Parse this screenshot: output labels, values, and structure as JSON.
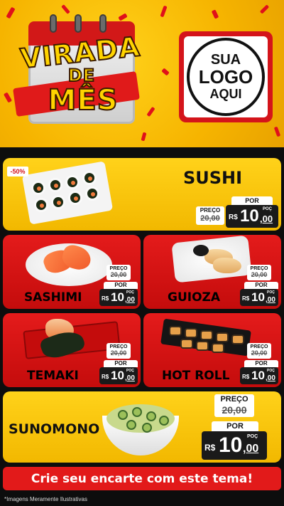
{
  "header": {
    "title_line1": "VIRADA",
    "title_line2": "DE",
    "title_line3": "MÊS",
    "logo_line1": "SUA",
    "logo_line2": "LOGO",
    "logo_line3": "AQUI"
  },
  "products": {
    "sushi": {
      "name": "SUSHI",
      "badge": "-50%",
      "old_label": "PREÇO",
      "old_price": "20,00",
      "por": "POR",
      "currency": "R$",
      "int": "10",
      "dec": ",00",
      "poc": "POÇ"
    },
    "sashimi": {
      "name": "SASHIMI",
      "old_label": "PREÇO",
      "old_price": "20,00",
      "por": "POR",
      "currency": "R$",
      "int": "10",
      "dec": ",00",
      "poc": "POÇ"
    },
    "guioza": {
      "name": "GUIOZA",
      "old_label": "PREÇO",
      "old_price": "20,00",
      "por": "POR",
      "currency": "R$",
      "int": "10",
      "dec": ",00",
      "poc": "POÇ"
    },
    "temaki": {
      "name": "TEMAKI",
      "old_label": "PREÇO",
      "old_price": "20,00",
      "por": "POR",
      "currency": "R$",
      "int": "10",
      "dec": ",00",
      "poc": "POÇ"
    },
    "hotroll": {
      "name": "HOT ROLL",
      "old_label": "PREÇO",
      "old_price": "20,00",
      "por": "POR",
      "currency": "R$",
      "int": "10",
      "dec": ",00",
      "poc": "POÇ"
    },
    "sunomono": {
      "name": "SUNOMONO",
      "old_label": "PREÇO",
      "old_price": "20,00",
      "por": "POR",
      "currency": "R$",
      "int": "10",
      "dec": ",00",
      "poc": "POÇ"
    }
  },
  "banner": {
    "text": "Crie seu encarte com este tema!"
  },
  "footnote": "*Imagens Meramente Ilustrativas",
  "colors": {
    "yellow": "#ffd21a",
    "red": "#e21a1a",
    "dark": "#1a1a1a"
  }
}
